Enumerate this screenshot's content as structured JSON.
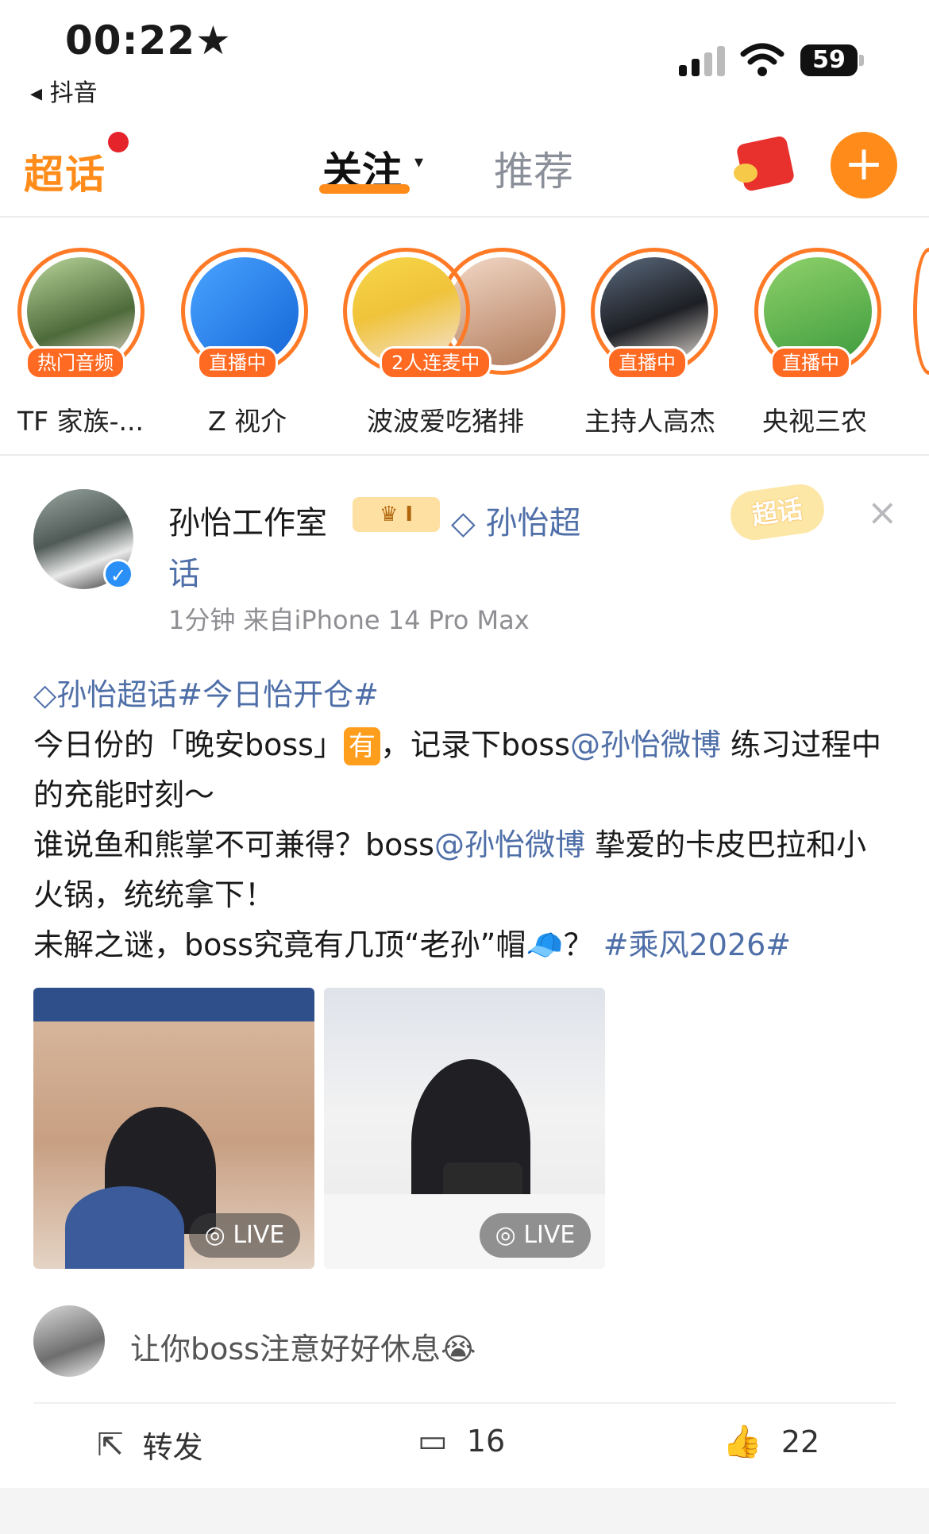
{
  "status_bar": {
    "time": "00:22",
    "back_label": "◂ 抖音",
    "battery": "59"
  },
  "nav": {
    "logo": "超话",
    "tab_follow": "关注",
    "tab_recommend": "推荐",
    "add": "+"
  },
  "stories": [
    {
      "badge": "热门音频",
      "name": "TF 家族-..."
    },
    {
      "badge": "直播中",
      "name": "Z 视介"
    },
    {
      "badge": "2人连麦中",
      "name": "波波爱吃猪排"
    },
    {
      "badge": "直播中",
      "name": "主持人高杰"
    },
    {
      "badge": "直播中",
      "name": "央视三农"
    }
  ],
  "post": {
    "author": "孙怡工作室",
    "crown_badge": "I",
    "topic_link_line1": "◇ 孙怡超",
    "topic_link_line2": "话",
    "meta": "1分钟  来自iPhone 14 Pro Max",
    "chaohua_badge": "超话",
    "close": "×",
    "content": {
      "tags": "◇孙怡超话#今日怡开仓#",
      "line1_a": "今日份的「晚安boss」",
      "line1_emoji": "有",
      "line1_b": "，记录下boss",
      "mention": "@孙怡微博",
      "line1_c": " 练习过程中的充能时刻～",
      "line2_a": "谁说鱼和熊掌不可兼得？boss",
      "line2_b": " 挚爱的卡皮巴拉和小火锅，统统拿下！",
      "line3_a": "未解之谜，boss究竟有几顶“老孙”帽🧢？",
      "line3_tag": "#乘风2026#"
    },
    "photos": [
      {
        "live": "LIVE"
      },
      {
        "live": "LIVE"
      }
    ],
    "comment": "让你boss注意好好休息😭",
    "actions": {
      "repost": "转发",
      "comments": "16",
      "likes": "22"
    }
  }
}
